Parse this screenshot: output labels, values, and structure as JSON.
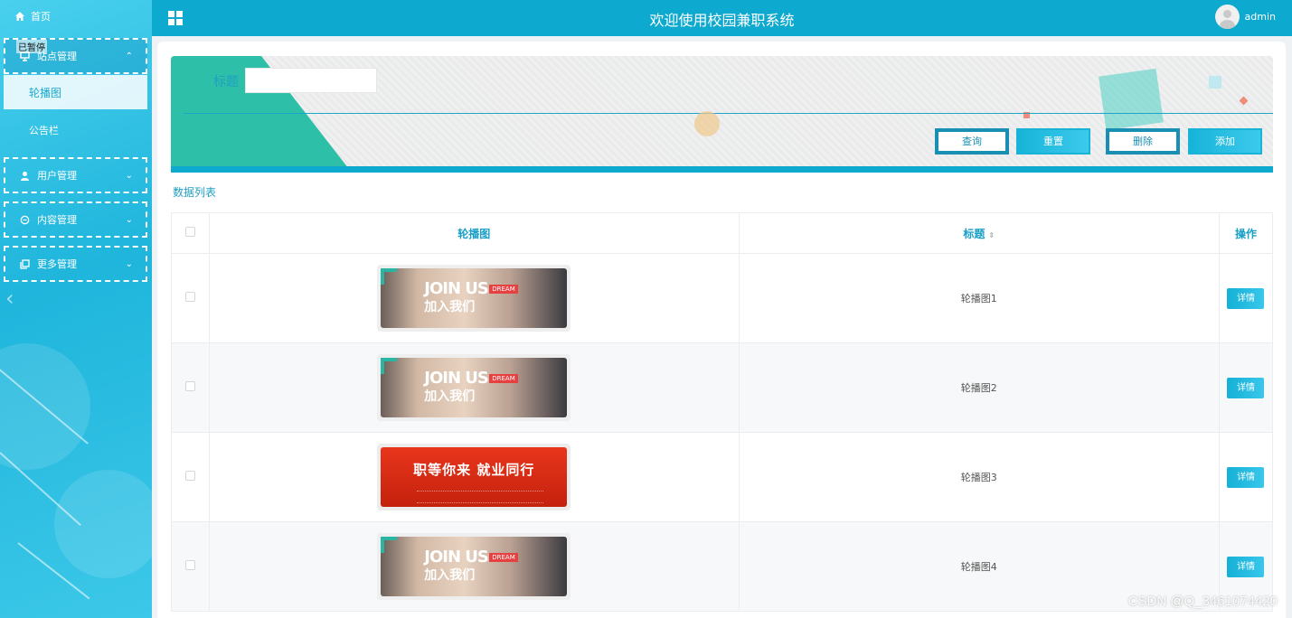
{
  "sidebar": {
    "home": "首页",
    "paused_overlay": "已暂停",
    "groups": [
      {
        "label": "站点管理",
        "icon": "monitor-icon",
        "expanded": true
      },
      {
        "label": "用户管理",
        "icon": "user-icon",
        "expanded": false
      },
      {
        "label": "内容管理",
        "icon": "chat-icon",
        "expanded": false
      },
      {
        "label": "更多管理",
        "icon": "copy-icon",
        "expanded": false
      }
    ],
    "sub_items": [
      {
        "label": "轮播图",
        "active": true
      },
      {
        "label": "公告栏",
        "active": false
      }
    ]
  },
  "header": {
    "title": "欢迎使用校园兼职系统",
    "username": "admin"
  },
  "search": {
    "label": "标题",
    "value": "",
    "buttons": {
      "query": "查询",
      "reset": "重置",
      "delete": "删除",
      "add": "添加"
    }
  },
  "list": {
    "title": "数据列表",
    "columns": {
      "image": "轮播图",
      "title": "标题",
      "actions": "操作"
    },
    "rows": [
      {
        "image": "join-us-banner",
        "image_text": "JOIN US",
        "image_sub": "加入我们",
        "image_tag": "DREAM",
        "title": "轮播图1",
        "action": "详情"
      },
      {
        "image": "join-us-banner",
        "image_text": "JOIN US",
        "image_sub": "加入我们",
        "image_tag": "DREAM",
        "title": "轮播图2",
        "action": "详情"
      },
      {
        "image": "job-fair-banner",
        "image_text": "职等你来  就业同行",
        "title": "轮播图3",
        "action": "详情"
      },
      {
        "image": "join-us-banner",
        "image_text": "JOIN US",
        "image_sub": "加入我们",
        "image_tag": "DREAM",
        "title": "轮播图4",
        "action": "详情"
      }
    ]
  },
  "watermark": "CSDN @Q_3461074420",
  "colors": {
    "primary": "#0ea9ce",
    "accent_teal": "#2dbfa8",
    "sidebar_gradient_start": "#49d0ee"
  }
}
